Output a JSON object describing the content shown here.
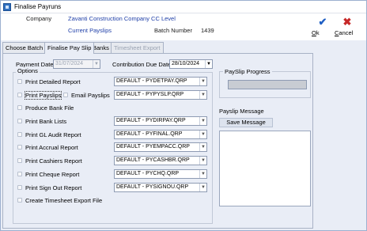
{
  "window": {
    "title": "Finalise Payruns"
  },
  "header": {
    "company_label": "Company",
    "company_value": "Zavanti Construction Company CC Level",
    "payslips_value": "Current Payslips",
    "batch_label": "Batch Number",
    "batch_value": "1439"
  },
  "toolbar": {
    "ok_label_first": "O",
    "ok_label_rest": "k",
    "cancel_label_first": "C",
    "cancel_label_rest": "ancel",
    "ok_icon": "checkmark-icon",
    "cancel_icon": "x-icon",
    "ok_color": "#1f5fc4",
    "cancel_color": "#c62828"
  },
  "tabs": [
    {
      "label": "Choose Batch",
      "state": "normal"
    },
    {
      "label": "Finalise Pay Slip",
      "state": "active"
    },
    {
      "label": "Banks",
      "state": "normal"
    },
    {
      "label": "Timesheet Export",
      "state": "disabled"
    }
  ],
  "dates": {
    "payment_label": "Payment Date",
    "payment_value": "31/07/2024",
    "contribution_label": "Contribution Due Date",
    "contribution_value": "28/10/2024"
  },
  "options": {
    "legend": "Options",
    "items": [
      {
        "label": "Print Detailed Report",
        "select": "DEFAULT - PYDETPAY.QRP"
      },
      {
        "label": "Print Payslips",
        "select": "DEFAULT - PYPYSLP.QRP",
        "extra": "Email Payslips"
      },
      {
        "label": "Produce Bank File"
      },
      {
        "label": "Print Bank Lists",
        "select": "DEFAULT - PYDIRPAY.QRP"
      },
      {
        "label": "Print GL Audit Report",
        "select": "DEFAULT - PYFINAL.QRP"
      },
      {
        "label": "Print Accrual Report",
        "select": "DEFAULT - PYEMPACC.QRP"
      },
      {
        "label": "Print Cashiers Report",
        "select": "DEFAULT - PYCASHBR.QRP"
      },
      {
        "label": "Print Cheque Report",
        "select": "DEFAULT - PYCHQ.QRP"
      },
      {
        "label": "Print Sign Out Report",
        "select": "DEFAULT - PYSIGNOU.QRP"
      },
      {
        "label": "Create Timesheet Export File"
      }
    ]
  },
  "progress": {
    "legend": "PaySlip Progress",
    "value": 0
  },
  "message": {
    "label": "Payslip Message",
    "save_label": "Save Message"
  }
}
